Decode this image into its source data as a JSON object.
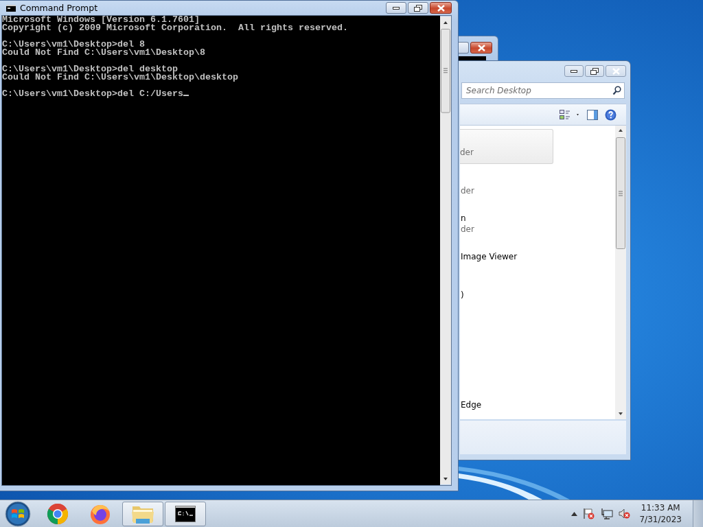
{
  "console_window": {
    "title": "Command Prompt",
    "blocks": [
      [
        "Microsoft Windows [Version 6.1.7601]",
        "Copyright (c) 2009 Microsoft Corporation.  All rights reserved."
      ],
      [
        "C:\\Users\\vm1\\Desktop>del 8",
        "Could Not Find C:\\Users\\vm1\\Desktop\\8"
      ],
      [
        "C:\\Users\\vm1\\Desktop>del desktop",
        "Could Not Find C:\\Users\\vm1\\Desktop\\desktop"
      ],
      [
        "C:\\Users\\vm1\\Desktop>del C:/Users"
      ]
    ]
  },
  "explorer_window": {
    "search": {
      "placeholder": "Search Desktop"
    },
    "items": [
      {
        "detail": "der",
        "selected": true
      },
      {
        "detail": "der",
        "selected": false
      },
      {
        "title": "n",
        "detail": "der",
        "selected": false
      },
      {
        "title": "Image Viewer",
        "selected": false
      },
      {
        "title": ")",
        "selected": false
      },
      {
        "title": "Edge",
        "selected": false
      }
    ]
  },
  "taskbar": {
    "apps": [
      {
        "kind": "start",
        "running": false
      },
      {
        "kind": "chrome",
        "running": false
      },
      {
        "kind": "firefox",
        "running": false
      },
      {
        "kind": "folder",
        "running": true
      },
      {
        "kind": "console",
        "running": true
      }
    ],
    "clock": {
      "time": "11:33 AM",
      "date": "7/31/2023"
    }
  }
}
